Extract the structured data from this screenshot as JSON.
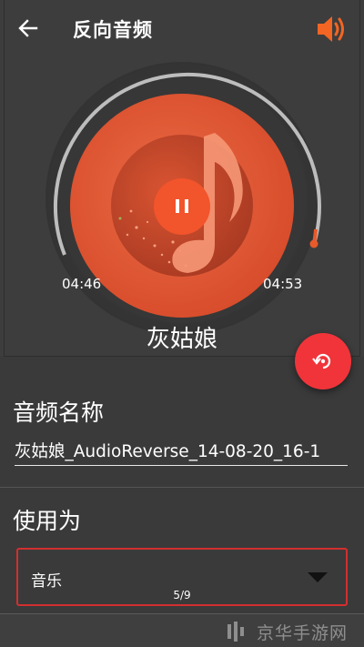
{
  "header": {
    "title": "反向音频",
    "back_icon": "arrow-left-icon",
    "volume_icon": "volume-icon"
  },
  "player": {
    "elapsed": "04:46",
    "total": "04:53",
    "progress": 0.976,
    "song_title": "灰姑娘",
    "pause_icon": "pause-icon",
    "art_icon": "music-note-icon",
    "fab_icon": "reverse-replay-icon",
    "accent_color": "#f0343a",
    "disc_color": "#e35b35"
  },
  "form": {
    "name_label": "音频名称",
    "name_value": "灰姑娘_AudioReverse_14-08-20_16-1",
    "use_label": "使用为",
    "use_selected": "音乐",
    "page_indicator": "5/9"
  },
  "watermark": {
    "text": "京华手游网"
  }
}
